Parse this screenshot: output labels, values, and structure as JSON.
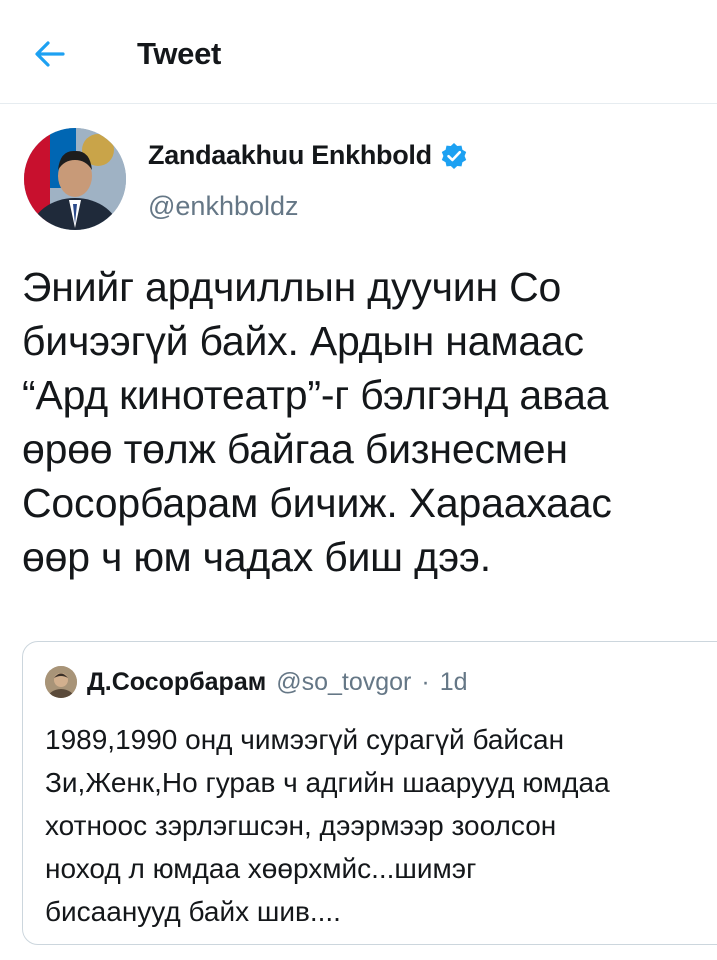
{
  "header": {
    "title": "Tweet",
    "back_icon": "arrow-left-icon",
    "accent": "#1da1f2"
  },
  "tweet": {
    "author_name": "Zandaakhuu Enkhbold",
    "verified_icon": "verified-badge-icon",
    "handle": "@enkhboldz",
    "text": "Энийг ардчиллын дуучин Со\nбичээгүй байх. Ардын намаас\n“Ард кинотеатр”-г бэлгэнд аваа\nөрөө төлж байгаа бизнесмен\nСосорбарам бичиж. Хараахаас\nөөр ч юм чадах биш дээ."
  },
  "quote": {
    "author_name": "Д.Сосорбарам",
    "handle": "@so_tovgor",
    "separator": "·",
    "age": "1d",
    "text": "1989,1990 онд чимээгүй сурагүй байсан\nЗи,Женк,Но гурав ч адгийн шаарууд юмдаа\nхотноос зэрлэгшсэн, дээрмээр зоолсон\nноход л юмдаа хөөрхмйс...шимэг\nбисаанууд байх шив...."
  }
}
